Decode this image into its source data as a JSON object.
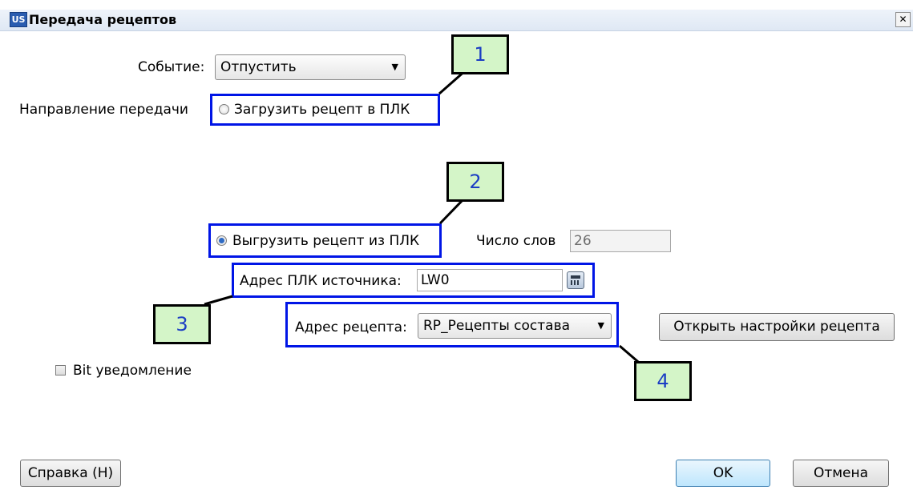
{
  "window": {
    "title": "Передача рецептов",
    "icon_text": "US",
    "close_symbol": "✕"
  },
  "event": {
    "label": "Событие:",
    "selected": "Отпустить"
  },
  "direction": {
    "label": "Направление передачи",
    "option_upload": "Загрузить рецепт в ПЛК",
    "option_download": "Выгрузить рецепт из ПЛК",
    "selected": "download"
  },
  "word_count": {
    "label": "Число слов",
    "value": "26"
  },
  "plc_source": {
    "label": "Адрес ПЛК источника:",
    "value": "LW0"
  },
  "recipe_address": {
    "label": "Адрес рецепта:",
    "selected": "RP_Рецепты состава"
  },
  "buttons": {
    "open_recipe_settings": "Открыть настройки рецепта",
    "help": "Справка (H)",
    "ok": "OK",
    "cancel": "Отмена"
  },
  "bit_notification": {
    "label": "Bit уведомление",
    "checked": false
  },
  "callouts": [
    "1",
    "2",
    "3",
    "4"
  ],
  "colors": {
    "highlight": "#0015e6",
    "callout_fill": "#d4f5c8",
    "callout_text": "#1c3ec4"
  }
}
